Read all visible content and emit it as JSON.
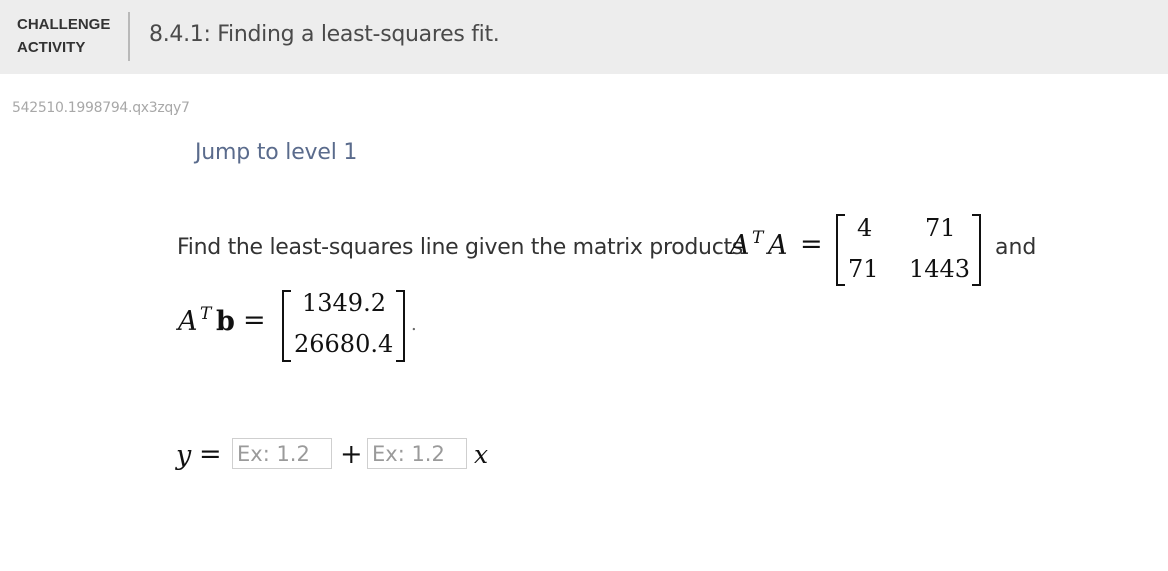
{
  "header": {
    "badge_line1": "CHALLENGE",
    "badge_line2": "ACTIVITY",
    "title": "8.4.1: Finding a least-squares fit."
  },
  "activity_id": "542510.1998794.qx3zqy7",
  "jump_link": "Jump to level 1",
  "prompt": {
    "text": "Find the least-squares line given the matrix products",
    "and": "and",
    "period": "."
  },
  "math": {
    "ata_lhs_A": "A",
    "ata_lhs_T": "T",
    "ata_lhs_A2": "A",
    "eq": "=",
    "ata_matrix": [
      [
        "4",
        "71"
      ],
      [
        "71",
        "1443"
      ]
    ],
    "atb_lhs_A": "A",
    "atb_lhs_T": "T",
    "atb_lhs_b": "b",
    "atb_vector": [
      "1349.2",
      "26680.4"
    ]
  },
  "answer": {
    "y_label": "y",
    "eq": "=",
    "plus": "+",
    "x_label": "x",
    "intercept_placeholder": "Ex: 1.2",
    "slope_placeholder": "Ex: 1.2",
    "intercept_value": "",
    "slope_value": ""
  }
}
